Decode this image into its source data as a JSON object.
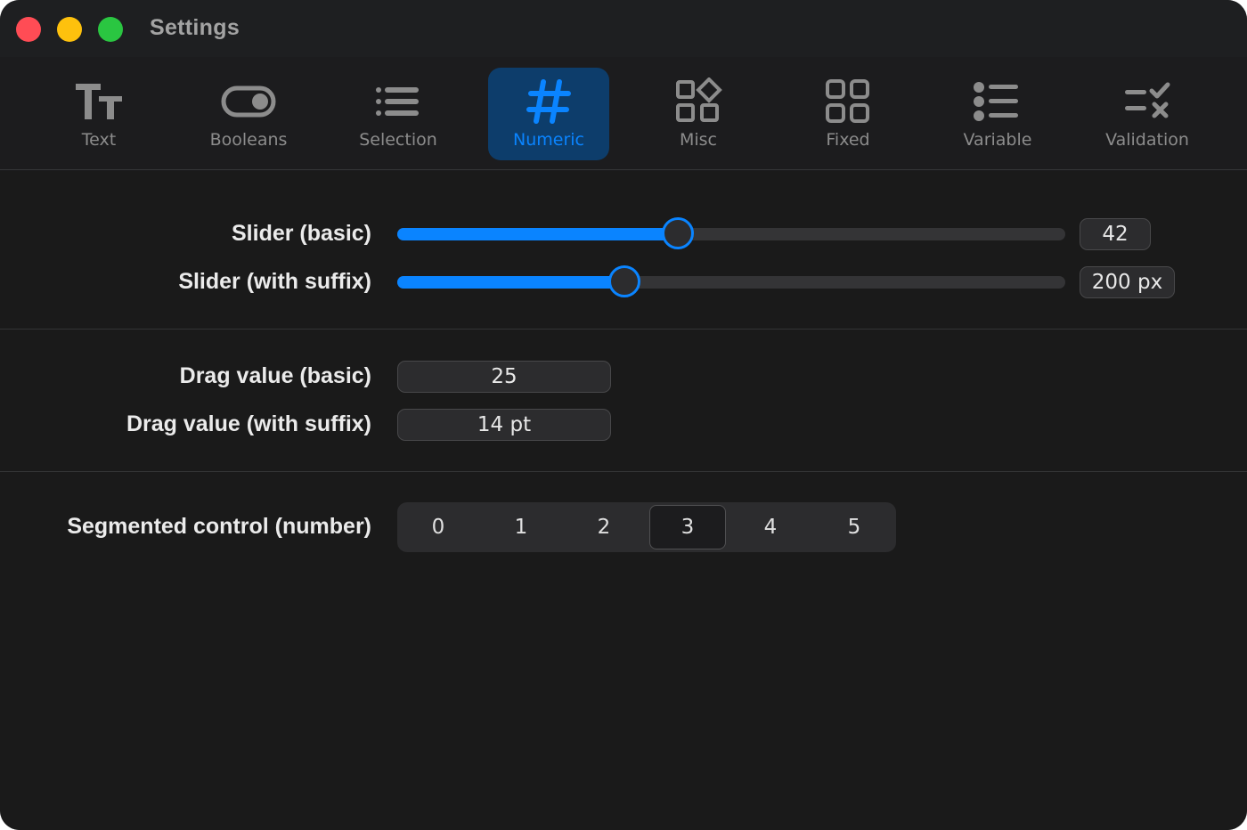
{
  "window": {
    "title": "Settings"
  },
  "toolbar": {
    "tabs": [
      {
        "label": "Text",
        "icon": "text-size-icon"
      },
      {
        "label": "Booleans",
        "icon": "toggle-icon"
      },
      {
        "label": "Selection",
        "icon": "list-icon"
      },
      {
        "label": "Numeric",
        "icon": "hash-icon",
        "active": true
      },
      {
        "label": "Misc",
        "icon": "shapes-icon"
      },
      {
        "label": "Fixed",
        "icon": "grid-icon"
      },
      {
        "label": "Variable",
        "icon": "bullet-list-icon"
      },
      {
        "label": "Validation",
        "icon": "validation-icon"
      }
    ]
  },
  "sliders": [
    {
      "label": "Slider (basic)",
      "value": "42",
      "fraction": 0.42
    },
    {
      "label": "Slider (with suffix)",
      "value": "200 px",
      "fraction": 0.34
    }
  ],
  "drags": [
    {
      "label": "Drag value (basic)",
      "value": "25"
    },
    {
      "label": "Drag value (with suffix)",
      "value": "14 pt"
    }
  ],
  "segmented": {
    "label": "Segmented control (number)",
    "options": [
      "0",
      "1",
      "2",
      "3",
      "4",
      "5"
    ],
    "selected": "3"
  },
  "colors": {
    "accent": "#0a84ff",
    "background": "#1a1a1a",
    "active_tab_bg": "#0d3d6b"
  }
}
